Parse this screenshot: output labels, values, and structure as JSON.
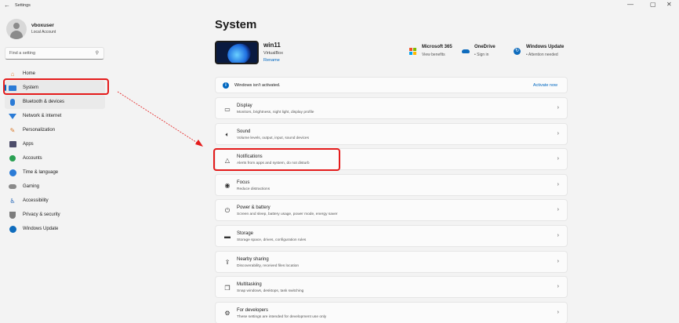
{
  "window": {
    "title": "Settings",
    "back_icon": "back-arrow-icon",
    "controls": [
      "—",
      "▢",
      "✕"
    ]
  },
  "user": {
    "name": "vboxuser",
    "account_type": "Local Account"
  },
  "search": {
    "placeholder": "Find a setting",
    "icon": "search-icon"
  },
  "sidebar": {
    "items": [
      {
        "label": "Home",
        "icon": "home-icon"
      },
      {
        "label": "System",
        "icon": "system-icon",
        "active": true
      },
      {
        "label": "Bluetooth & devices",
        "icon": "bluetooth-icon"
      },
      {
        "label": "Network & internet",
        "icon": "wifi-icon"
      },
      {
        "label": "Personalization",
        "icon": "brush-icon"
      },
      {
        "label": "Apps",
        "icon": "apps-icon"
      },
      {
        "label": "Accounts",
        "icon": "person-icon"
      },
      {
        "label": "Time & language",
        "icon": "globe-icon"
      },
      {
        "label": "Gaming",
        "icon": "gamepad-icon"
      },
      {
        "label": "Accessibility",
        "icon": "accessibility-icon"
      },
      {
        "label": "Privacy & security",
        "icon": "shield-icon"
      },
      {
        "label": "Windows Update",
        "icon": "update-icon"
      }
    ]
  },
  "main": {
    "title": "System",
    "device": {
      "name": "win11",
      "model": "VirtualBox",
      "rename_label": "Rename"
    },
    "quick_links": [
      {
        "name": "Microsoft 365",
        "status": "View benefits",
        "icon": "microsoft-logo-icon"
      },
      {
        "name": "OneDrive",
        "status": "• Sign in",
        "icon": "cloud-icon"
      },
      {
        "name": "Windows Update",
        "status": "• Attention needed",
        "icon": "update-icon"
      }
    ],
    "activation": {
      "message": "Windows isn't activated.",
      "link": "Activate now",
      "icon": "info-icon"
    },
    "settings": [
      {
        "title": "Display",
        "desc": "Monitors, brightness, night light, display profile",
        "icon": "monitor-icon"
      },
      {
        "title": "Sound",
        "desc": "Volume levels, output, input, sound devices",
        "icon": "speaker-icon"
      },
      {
        "title": "Notifications",
        "desc": "Alerts from apps and system, do not disturb",
        "icon": "bell-icon"
      },
      {
        "title": "Focus",
        "desc": "Reduce distractions",
        "icon": "focus-icon"
      },
      {
        "title": "Power & battery",
        "desc": "Screen and sleep, battery usage, power mode, energy saver",
        "icon": "power-icon"
      },
      {
        "title": "Storage",
        "desc": "Storage space, drives, configuration rules",
        "icon": "storage-icon"
      },
      {
        "title": "Nearby sharing",
        "desc": "Discoverability, received files location",
        "icon": "share-icon"
      },
      {
        "title": "Multitasking",
        "desc": "Snap windows, desktops, task switching",
        "icon": "multitasking-icon"
      },
      {
        "title": "For developers",
        "desc": "These settings are intended for development use only",
        "icon": "developer-icon"
      }
    ]
  },
  "colors": {
    "accent": "#0067c0",
    "annotation": "#e41b1b"
  }
}
